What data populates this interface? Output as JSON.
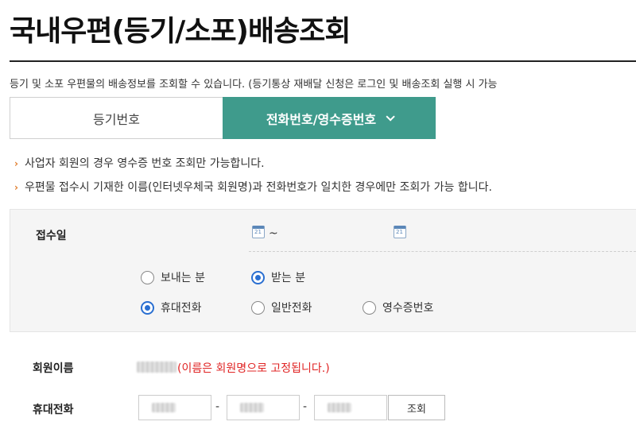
{
  "page_title": "국내우편(등기/소포)배송조회",
  "description": "등기 및 소포 우편물의 배송정보를 조회할 수 있습니다. (등기통상 재배달 신청은 로그인 및 배송조회 실행 시 가능",
  "tabs": [
    {
      "label": "등기번호",
      "active": false
    },
    {
      "label": "전화번호/영수증번호",
      "active": true
    }
  ],
  "notes": [
    "사업자 회원의 경우 영수증 번호 조회만 가능합니다.",
    "우편물 접수시 기재한 이름(인터넷우체국 회원명)과 전화번호가 일치한 경우에만 조회가 가능 합니다."
  ],
  "form": {
    "date_label": "접수일",
    "date_separator": "~",
    "party_options": [
      {
        "label": "보내는 분",
        "selected": false
      },
      {
        "label": "받는 분",
        "selected": true
      }
    ],
    "type_options": [
      {
        "label": "휴대전화",
        "selected": true
      },
      {
        "label": "일반전화",
        "selected": false
      },
      {
        "label": "영수증번호",
        "selected": false
      }
    ],
    "member_name_label": "회원이름",
    "member_name_note": "(이름은 회원명으로 고정됩니다.)",
    "phone_label": "휴대전화",
    "phone_separator": "-",
    "search_button": "조회"
  },
  "colors": {
    "active_tab": "#3f9b8c",
    "note_arrow": "#e07b2a",
    "warning_text": "#e02424",
    "radio_selected": "#2a6fd1"
  }
}
